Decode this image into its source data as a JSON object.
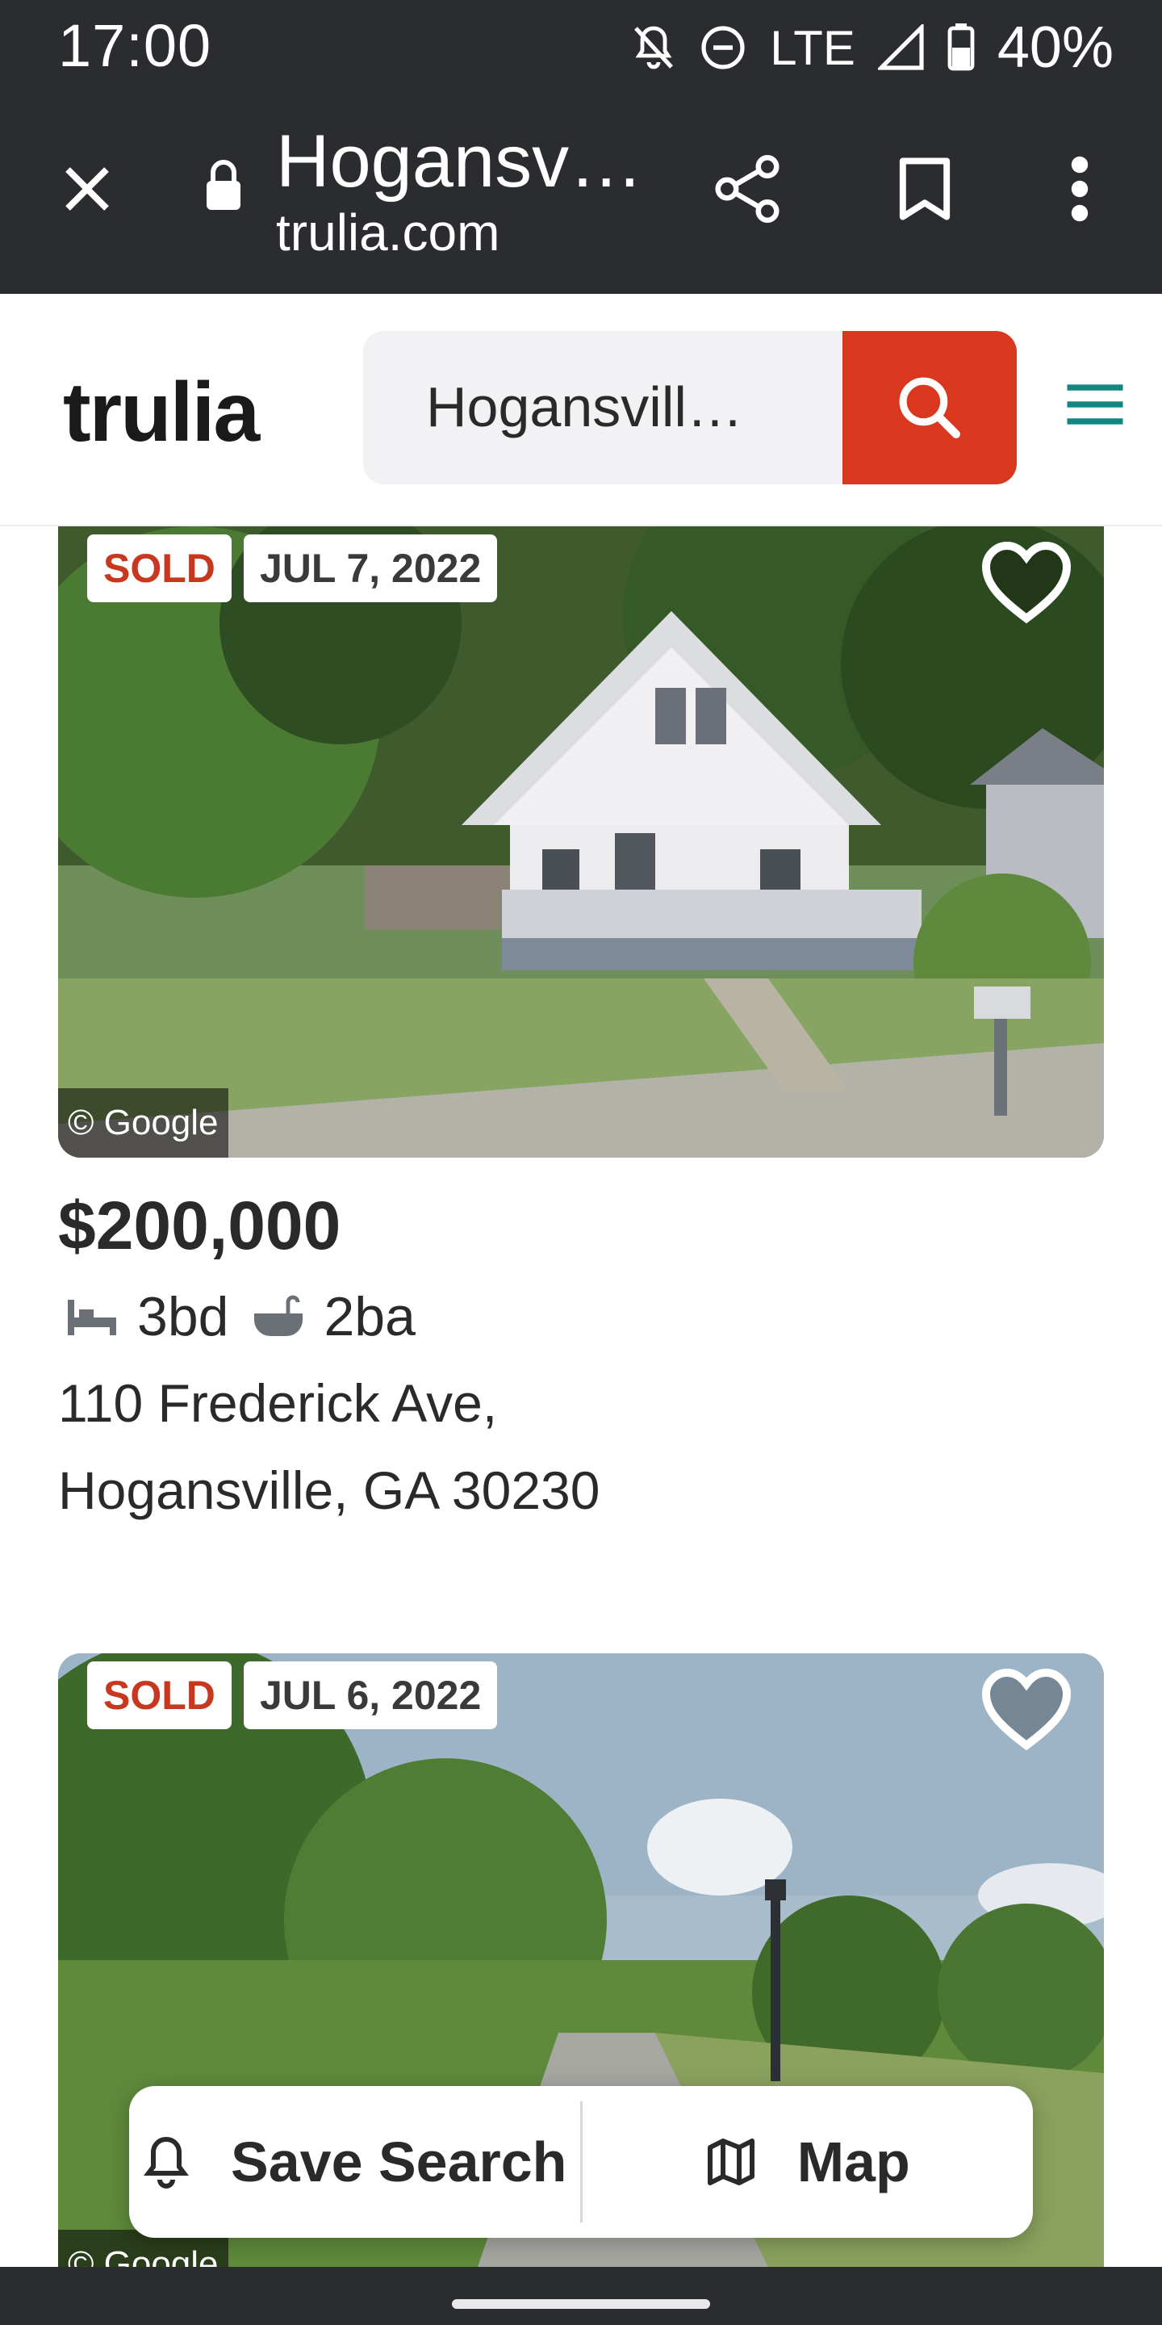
{
  "status_bar": {
    "time": "17:00",
    "network": "LTE",
    "battery": "40%",
    "icons": [
      "notifications-off-icon",
      "do-not-disturb-icon",
      "signal-icon",
      "battery-icon"
    ]
  },
  "browser": {
    "title": "Hogansv…",
    "domain": "trulia.com",
    "icons": [
      "close-icon",
      "lock-icon",
      "share-icon",
      "bookmark-icon",
      "more-vert-icon"
    ]
  },
  "header": {
    "logo": "trulia",
    "search_value": "Hogansvill…",
    "icons": [
      "search-icon",
      "menu-icon"
    ],
    "colors": {
      "search_button": "#d9381e",
      "menu": "#138684"
    }
  },
  "listings": [
    {
      "status": "SOLD",
      "date": "JUL 7, 2022",
      "image_credit": "© Google",
      "price": "$200,000",
      "beds": "3bd",
      "baths": "2ba",
      "address_line1": "110 Frederick Ave,",
      "address_line2": "Hogansville, GA 30230"
    },
    {
      "status": "SOLD",
      "date": "JUL 6, 2022",
      "image_credit": "© Google"
    }
  ],
  "float_bar": {
    "save_search": "Save Search",
    "map": "Map"
  }
}
